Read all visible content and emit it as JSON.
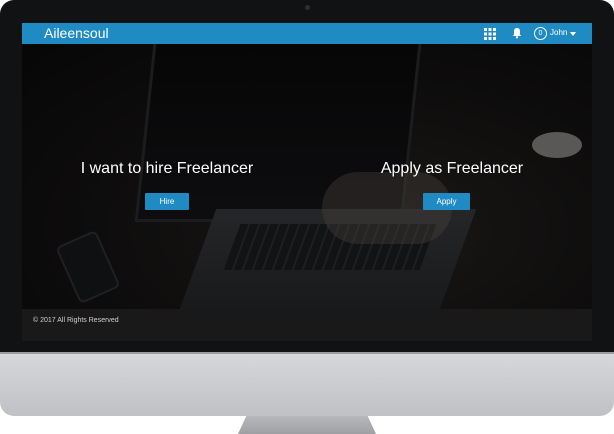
{
  "header": {
    "brand": "Aileensoul",
    "notification_count": "0",
    "username": "John"
  },
  "hero": {
    "hire_title": "I want to hire Freelancer",
    "hire_button_label": "Hire",
    "apply_title": "Apply as Freelancer",
    "apply_button_label": "Apply"
  },
  "footer": {
    "copyright": "© 2017 All Rights Reserved"
  },
  "colors": {
    "accent": "#1f8bc2",
    "footer_bg": "#19191a",
    "hero_bg": "#161414"
  },
  "icons": [
    "grid-icon",
    "bell-icon",
    "caret-down-icon"
  ]
}
